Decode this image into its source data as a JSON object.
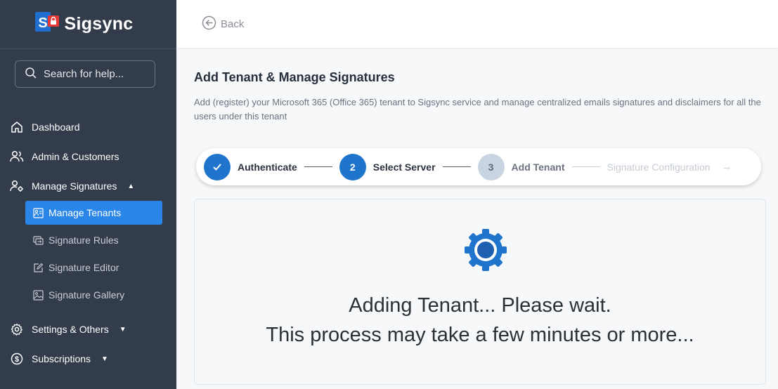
{
  "sidebar": {
    "brand": "Sigsync",
    "search_placeholder": "Search for help...",
    "items": [
      {
        "label": "Dashboard",
        "icon": "home-icon"
      },
      {
        "label": "Admin & Customers",
        "icon": "users-icon"
      },
      {
        "label": "Manage Signatures",
        "icon": "user-gear-icon"
      },
      {
        "label": "Settings & Others",
        "icon": "gear-icon"
      },
      {
        "label": "Subscriptions",
        "icon": "dollar-icon"
      }
    ],
    "sub_items": [
      {
        "label": "Manage Tenants",
        "icon": "tenant-icon",
        "active": true
      },
      {
        "label": "Signature Rules",
        "icon": "rules-icon"
      },
      {
        "label": "Signature Editor",
        "icon": "edit-icon"
      },
      {
        "label": "Signature Gallery",
        "icon": "gallery-icon"
      }
    ]
  },
  "topbar": {
    "back_label": "Back"
  },
  "main": {
    "title": "Add Tenant & Manage Signatures",
    "description": "Add (register) your Microsoft 365 (Office 365) tenant to Sigsync service and manage centralized emails signatures and disclaimers for all the users under this tenant",
    "steps": [
      {
        "number": "",
        "label": "Authenticate",
        "state": "done"
      },
      {
        "number": "2",
        "label": "Select Server",
        "state": "active"
      },
      {
        "number": "3",
        "label": "Add Tenant",
        "state": "pending"
      },
      {
        "number": "",
        "label": "Signature Configuration",
        "state": "disabled"
      }
    ],
    "status_line1": "Adding Tenant... Please wait.",
    "status_line2": "This process may take a few minutes or more..."
  },
  "colors": {
    "sidebar_bg": "#333c4a",
    "accent": "#2a85e8",
    "step_active": "#1f75cc",
    "step_pending": "#c9d4e2"
  }
}
